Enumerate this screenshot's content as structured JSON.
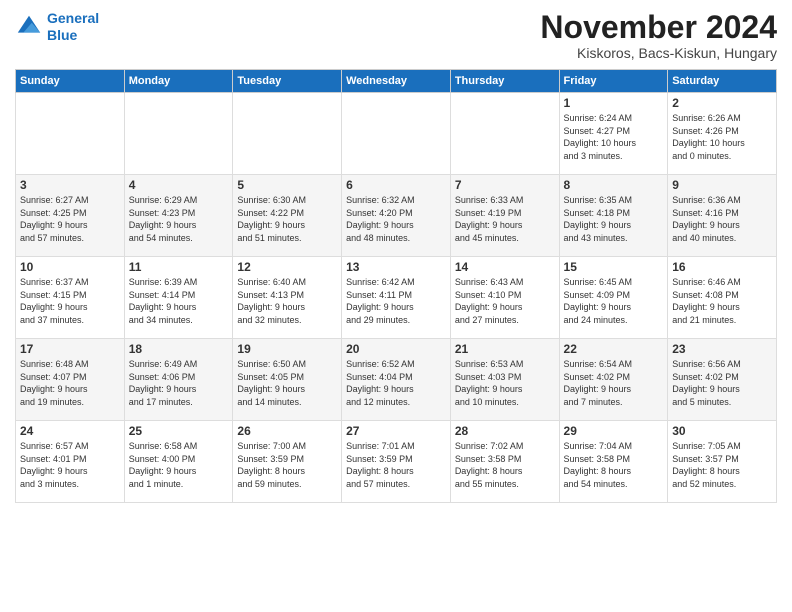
{
  "header": {
    "logo_line1": "General",
    "logo_line2": "Blue",
    "month_title": "November 2024",
    "location": "Kiskoros, Bacs-Kiskun, Hungary"
  },
  "weekdays": [
    "Sunday",
    "Monday",
    "Tuesday",
    "Wednesday",
    "Thursday",
    "Friday",
    "Saturday"
  ],
  "weeks": [
    [
      {
        "day": "",
        "info": ""
      },
      {
        "day": "",
        "info": ""
      },
      {
        "day": "",
        "info": ""
      },
      {
        "day": "",
        "info": ""
      },
      {
        "day": "",
        "info": ""
      },
      {
        "day": "1",
        "info": "Sunrise: 6:24 AM\nSunset: 4:27 PM\nDaylight: 10 hours\nand 3 minutes."
      },
      {
        "day": "2",
        "info": "Sunrise: 6:26 AM\nSunset: 4:26 PM\nDaylight: 10 hours\nand 0 minutes."
      }
    ],
    [
      {
        "day": "3",
        "info": "Sunrise: 6:27 AM\nSunset: 4:25 PM\nDaylight: 9 hours\nand 57 minutes."
      },
      {
        "day": "4",
        "info": "Sunrise: 6:29 AM\nSunset: 4:23 PM\nDaylight: 9 hours\nand 54 minutes."
      },
      {
        "day": "5",
        "info": "Sunrise: 6:30 AM\nSunset: 4:22 PM\nDaylight: 9 hours\nand 51 minutes."
      },
      {
        "day": "6",
        "info": "Sunrise: 6:32 AM\nSunset: 4:20 PM\nDaylight: 9 hours\nand 48 minutes."
      },
      {
        "day": "7",
        "info": "Sunrise: 6:33 AM\nSunset: 4:19 PM\nDaylight: 9 hours\nand 45 minutes."
      },
      {
        "day": "8",
        "info": "Sunrise: 6:35 AM\nSunset: 4:18 PM\nDaylight: 9 hours\nand 43 minutes."
      },
      {
        "day": "9",
        "info": "Sunrise: 6:36 AM\nSunset: 4:16 PM\nDaylight: 9 hours\nand 40 minutes."
      }
    ],
    [
      {
        "day": "10",
        "info": "Sunrise: 6:37 AM\nSunset: 4:15 PM\nDaylight: 9 hours\nand 37 minutes."
      },
      {
        "day": "11",
        "info": "Sunrise: 6:39 AM\nSunset: 4:14 PM\nDaylight: 9 hours\nand 34 minutes."
      },
      {
        "day": "12",
        "info": "Sunrise: 6:40 AM\nSunset: 4:13 PM\nDaylight: 9 hours\nand 32 minutes."
      },
      {
        "day": "13",
        "info": "Sunrise: 6:42 AM\nSunset: 4:11 PM\nDaylight: 9 hours\nand 29 minutes."
      },
      {
        "day": "14",
        "info": "Sunrise: 6:43 AM\nSunset: 4:10 PM\nDaylight: 9 hours\nand 27 minutes."
      },
      {
        "day": "15",
        "info": "Sunrise: 6:45 AM\nSunset: 4:09 PM\nDaylight: 9 hours\nand 24 minutes."
      },
      {
        "day": "16",
        "info": "Sunrise: 6:46 AM\nSunset: 4:08 PM\nDaylight: 9 hours\nand 21 minutes."
      }
    ],
    [
      {
        "day": "17",
        "info": "Sunrise: 6:48 AM\nSunset: 4:07 PM\nDaylight: 9 hours\nand 19 minutes."
      },
      {
        "day": "18",
        "info": "Sunrise: 6:49 AM\nSunset: 4:06 PM\nDaylight: 9 hours\nand 17 minutes."
      },
      {
        "day": "19",
        "info": "Sunrise: 6:50 AM\nSunset: 4:05 PM\nDaylight: 9 hours\nand 14 minutes."
      },
      {
        "day": "20",
        "info": "Sunrise: 6:52 AM\nSunset: 4:04 PM\nDaylight: 9 hours\nand 12 minutes."
      },
      {
        "day": "21",
        "info": "Sunrise: 6:53 AM\nSunset: 4:03 PM\nDaylight: 9 hours\nand 10 minutes."
      },
      {
        "day": "22",
        "info": "Sunrise: 6:54 AM\nSunset: 4:02 PM\nDaylight: 9 hours\nand 7 minutes."
      },
      {
        "day": "23",
        "info": "Sunrise: 6:56 AM\nSunset: 4:02 PM\nDaylight: 9 hours\nand 5 minutes."
      }
    ],
    [
      {
        "day": "24",
        "info": "Sunrise: 6:57 AM\nSunset: 4:01 PM\nDaylight: 9 hours\nand 3 minutes."
      },
      {
        "day": "25",
        "info": "Sunrise: 6:58 AM\nSunset: 4:00 PM\nDaylight: 9 hours\nand 1 minute."
      },
      {
        "day": "26",
        "info": "Sunrise: 7:00 AM\nSunset: 3:59 PM\nDaylight: 8 hours\nand 59 minutes."
      },
      {
        "day": "27",
        "info": "Sunrise: 7:01 AM\nSunset: 3:59 PM\nDaylight: 8 hours\nand 57 minutes."
      },
      {
        "day": "28",
        "info": "Sunrise: 7:02 AM\nSunset: 3:58 PM\nDaylight: 8 hours\nand 55 minutes."
      },
      {
        "day": "29",
        "info": "Sunrise: 7:04 AM\nSunset: 3:58 PM\nDaylight: 8 hours\nand 54 minutes."
      },
      {
        "day": "30",
        "info": "Sunrise: 7:05 AM\nSunset: 3:57 PM\nDaylight: 8 hours\nand 52 minutes."
      }
    ]
  ]
}
